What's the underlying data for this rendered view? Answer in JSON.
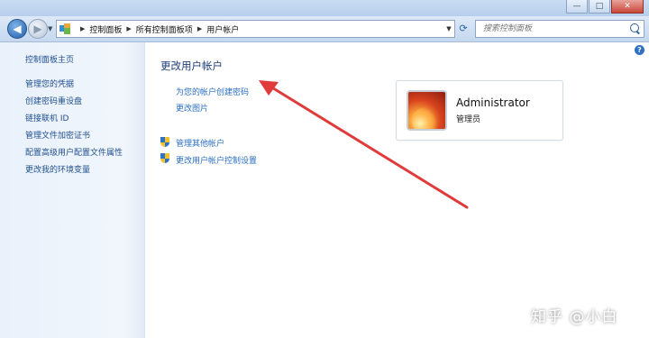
{
  "window": {
    "minimize_glyph": "—",
    "maximize_glyph": "□",
    "close_glyph": "✕"
  },
  "nav": {
    "back_glyph": "◀",
    "forward_glyph": "▶",
    "breadcrumbs": [
      "控制面板",
      "所有控制面板项",
      "用户帐户"
    ],
    "search_placeholder": "搜索控制面板"
  },
  "sidebar": {
    "home": "控制面板主页",
    "items": [
      "管理您的凭据",
      "创建密码重设盘",
      "链接联机 ID",
      "管理文件加密证书",
      "配置高级用户配置文件属性",
      "更改我的环境变量"
    ]
  },
  "main": {
    "title": "更改用户帐户",
    "links": [
      "为您的帐户创建密码",
      "更改图片"
    ],
    "shield_links": [
      "管理其他帐户",
      "更改用户帐户控制设置"
    ]
  },
  "user": {
    "name": "Administrator",
    "role": "管理员"
  },
  "help_glyph": "?",
  "watermark": "知乎 @小白",
  "annotation_color": "#e03a3a"
}
